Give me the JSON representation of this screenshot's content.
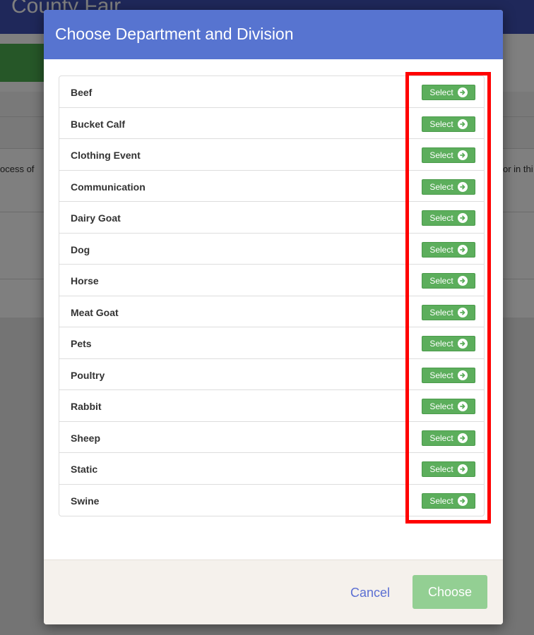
{
  "background": {
    "header_title": "County Fair",
    "text_left": "ocess of",
    "text_right": "or in thi"
  },
  "modal": {
    "title": "Choose Department and Division",
    "items": [
      {
        "label": "Beef",
        "button": "Select"
      },
      {
        "label": "Bucket Calf",
        "button": "Select"
      },
      {
        "label": "Clothing Event",
        "button": "Select"
      },
      {
        "label": "Communication",
        "button": "Select"
      },
      {
        "label": "Dairy Goat",
        "button": "Select"
      },
      {
        "label": "Dog",
        "button": "Select"
      },
      {
        "label": "Horse",
        "button": "Select"
      },
      {
        "label": "Meat Goat",
        "button": "Select"
      },
      {
        "label": "Pets",
        "button": "Select"
      },
      {
        "label": "Poultry",
        "button": "Select"
      },
      {
        "label": "Rabbit",
        "button": "Select"
      },
      {
        "label": "Sheep",
        "button": "Select"
      },
      {
        "label": "Static",
        "button": "Select"
      },
      {
        "label": "Swine",
        "button": "Select"
      }
    ],
    "footer": {
      "cancel_label": "Cancel",
      "choose_label": "Choose"
    }
  },
  "icons": {
    "select_button_icon": "arrow-circle-right-icon"
  },
  "colors": {
    "header_bg": "#5774d0",
    "select_button": "#5cae5c",
    "choose_button_disabled": "#93cf93",
    "cancel_link": "#5b6fd3",
    "highlight_outline": "#ff0000",
    "footer_bg": "#f5f1ec"
  }
}
